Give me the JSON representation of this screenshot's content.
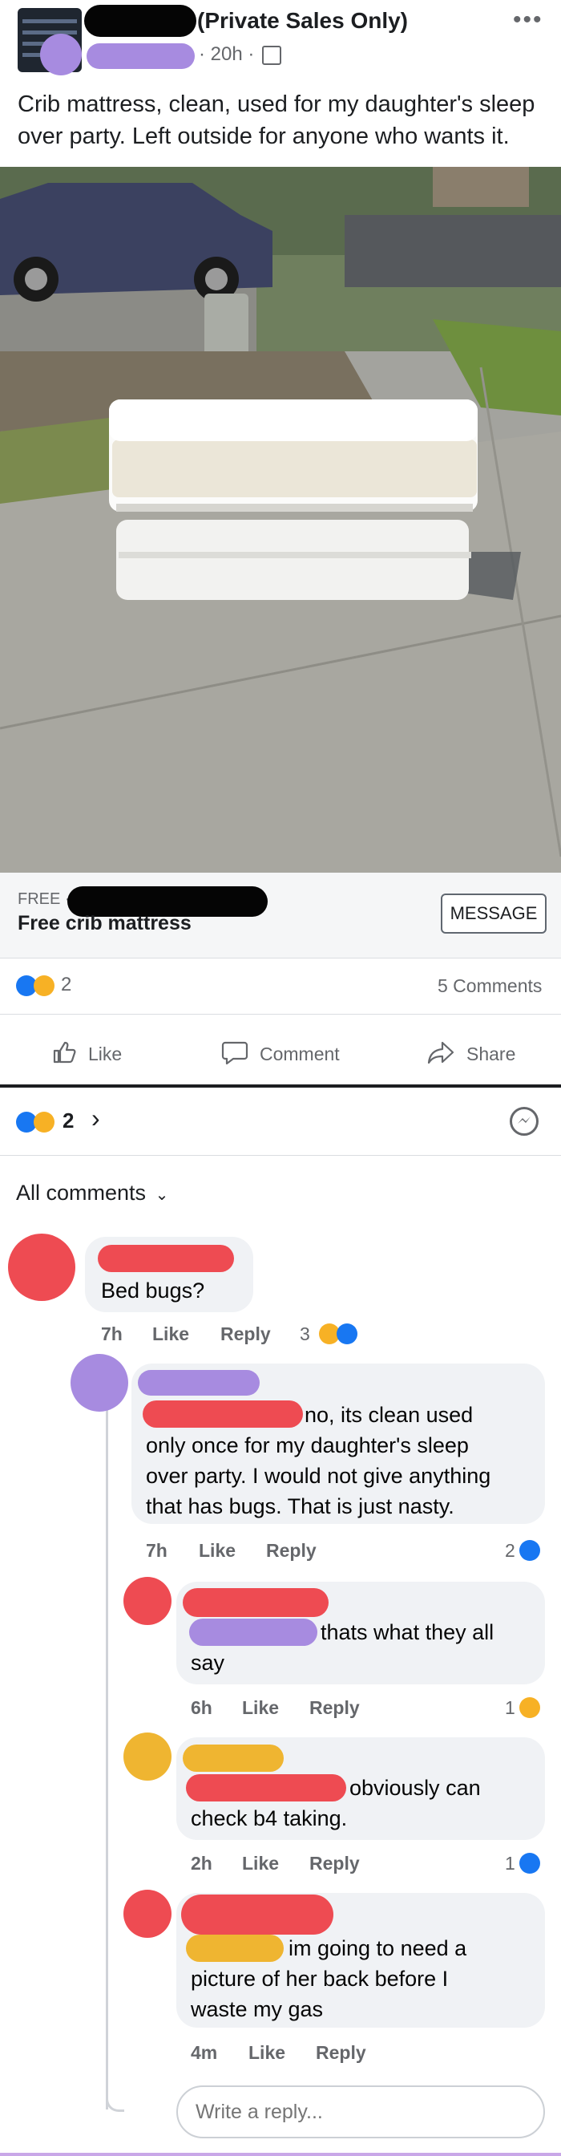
{
  "post": {
    "group_suffix": "(Private Sales Only)",
    "time": "20h",
    "text": "Crib mattress, clean,  used for my daughter's  sleep over party. Left outside for anyone who wants  it."
  },
  "listing": {
    "price": "FREE ·",
    "title": "Free crib mattress",
    "message_button": "MESSAGE"
  },
  "stats": {
    "reaction_count": "2",
    "comments_count": "5 Comments"
  },
  "actions": {
    "like": "Like",
    "comment": "Comment",
    "share": "Share"
  },
  "comments_header": {
    "reaction_count": "2",
    "filter": "All comments"
  },
  "comments": [
    {
      "text": "Bed bugs?",
      "time": "7h",
      "like": "Like",
      "reply": "Reply",
      "reactions": "3"
    },
    {
      "line1": "no, its clean used",
      "line2": "only once for my daughter's sleep",
      "line3": "over party. I would not give anything",
      "line4": "that has bugs. That is just nasty.",
      "time": "7h",
      "like": "Like",
      "reply": "Reply",
      "reactions": "2"
    },
    {
      "line1": "thats what they all",
      "line2": "say",
      "time": "6h",
      "like": "Like",
      "reply": "Reply",
      "reactions": "1"
    },
    {
      "line1": "obviously can",
      "line2": "check b4 taking.",
      "time": "2h",
      "like": "Like",
      "reply": "Reply",
      "reactions": "1"
    },
    {
      "line1": "im going to need a",
      "line2": "picture of her back before I",
      "line3": "waste my gas",
      "time": "4m",
      "like": "Like",
      "reply": "Reply"
    }
  ],
  "reply_box": {
    "placeholder": "Write a reply..."
  },
  "icons": {
    "more": "more-icon",
    "privacy": "group-icon",
    "like": "like-icon",
    "comment": "comment-icon",
    "share": "share-icon",
    "messenger": "messenger-icon",
    "chevron": "chevron-right-icon",
    "dropdown": "chevron-down-icon"
  },
  "colors": {
    "like_blue": "#1877f2",
    "haha_yellow": "#f7b125",
    "text": "#1c1e21",
    "muted": "#65676b",
    "bubble": "#f0f2f5"
  }
}
